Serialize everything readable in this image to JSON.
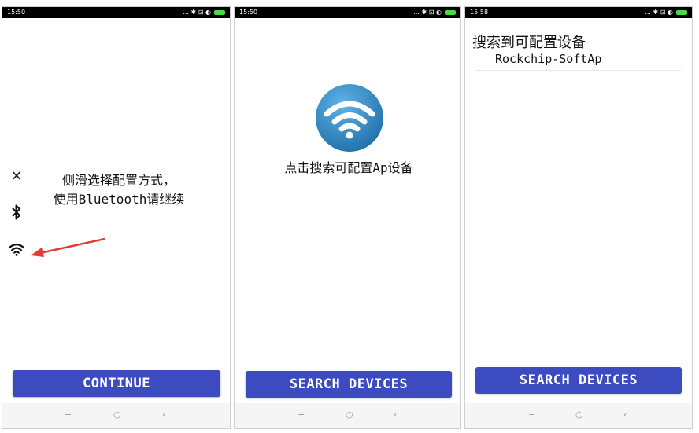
{
  "screens": [
    {
      "status_time": "15:50",
      "status_icons": "... ✱ ⊡ ◐",
      "menu": {
        "close_glyph": "✕",
        "bluetooth_glyph": "✱"
      },
      "instruction_line1": "侧滑选择配置方式，",
      "instruction_line2": "使用Bluetooth请继续",
      "button": "CONTINUE"
    },
    {
      "status_time": "15:50",
      "status_icons": "... ✱ ⊡ ◐",
      "prompt": "点击搜索可配置Ap设备",
      "button": "SEARCH DEVICES"
    },
    {
      "status_time": "15:58",
      "status_icons": "... ✱ ⊡ ◐",
      "heading": "搜索到可配置设备",
      "devices": [
        "Rockchip-SoftAp"
      ],
      "button": "SEARCH DEVICES"
    }
  ],
  "navbar": {
    "menu_glyph": "≡",
    "home_glyph": "○",
    "back_glyph": "‹"
  },
  "colors": {
    "button": "#3c4cc0",
    "wifi_badge": "#2f86c4",
    "arrow": "#e53935",
    "battery": "#4bd84b"
  }
}
